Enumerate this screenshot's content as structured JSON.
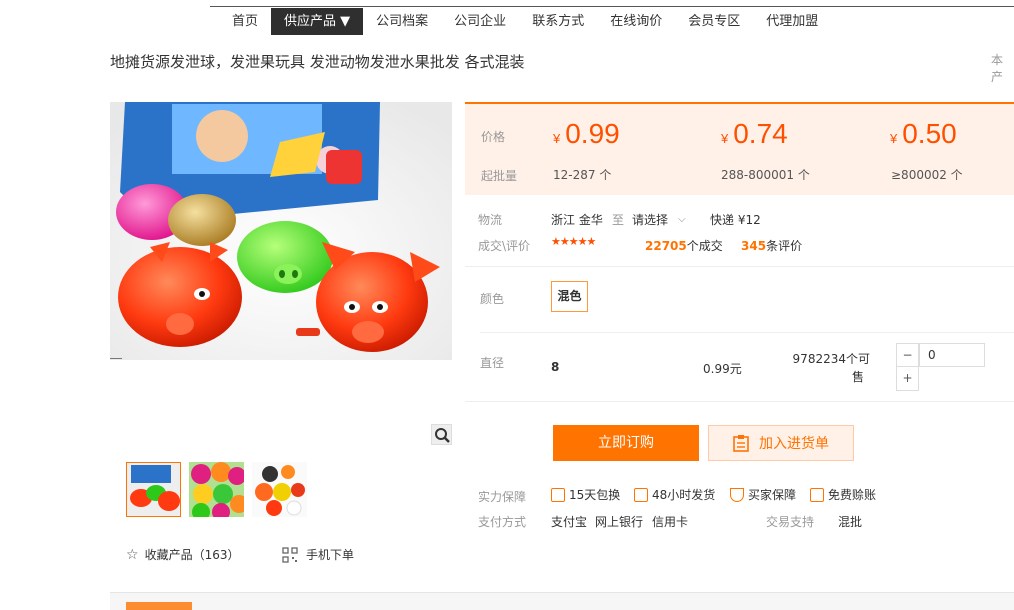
{
  "nav": {
    "items": [
      "首页",
      "供应产品 ▼",
      "公司档案",
      "公司企业",
      "联系方式",
      "在线询价",
      "会员专区",
      "代理加盟"
    ]
  },
  "product": {
    "title": "地摊货源发泄球，发泄果玩具 发泄动物发泄水果批发 各式混装",
    "title_right": "本产"
  },
  "price": {
    "label": "价格",
    "moq_label": "起批量",
    "currency": "¥",
    "tiers": [
      {
        "price": "0.99",
        "qty": "12-287 个"
      },
      {
        "price": "0.74",
        "qty": "288-800001 个"
      },
      {
        "price": "0.50",
        "qty": "≥800002 个"
      }
    ]
  },
  "logistics": {
    "label": "物流",
    "from": "浙江 金华",
    "to_word": "至",
    "select": "请选择",
    "express": "快递 ¥12"
  },
  "deal": {
    "label": "成交\\评价",
    "rating": 4.5,
    "deals_count": "22705",
    "deals_suffix": "个成交",
    "reviews_count": "345",
    "reviews_suffix": "条评价"
  },
  "color": {
    "label": "颜色",
    "option": "混色"
  },
  "spec": {
    "label": "直径",
    "value": "8",
    "price": "0.99元",
    "stock": "9782234个可",
    "stock_line2": "售",
    "qty": "0"
  },
  "actions": {
    "buy": "立即订购",
    "cart": "加入进货单"
  },
  "guarantee": {
    "label": "实力保障",
    "items": [
      "15天包换",
      "48小时发货",
      "买家保障",
      "免费赊账"
    ]
  },
  "payment": {
    "label": "支付方式",
    "methods": [
      "支付宝",
      "网上银行",
      "信用卡"
    ],
    "trade_label": "交易支持",
    "trade_value": "混批"
  },
  "footer": {
    "collect": "收藏产品（163）",
    "mobile": "手机下单"
  },
  "colors": {
    "accent": "#ff7300",
    "price": "#ff5000",
    "price_bg": "#fff1e8",
    "nav_active": "#2f2f2f"
  }
}
